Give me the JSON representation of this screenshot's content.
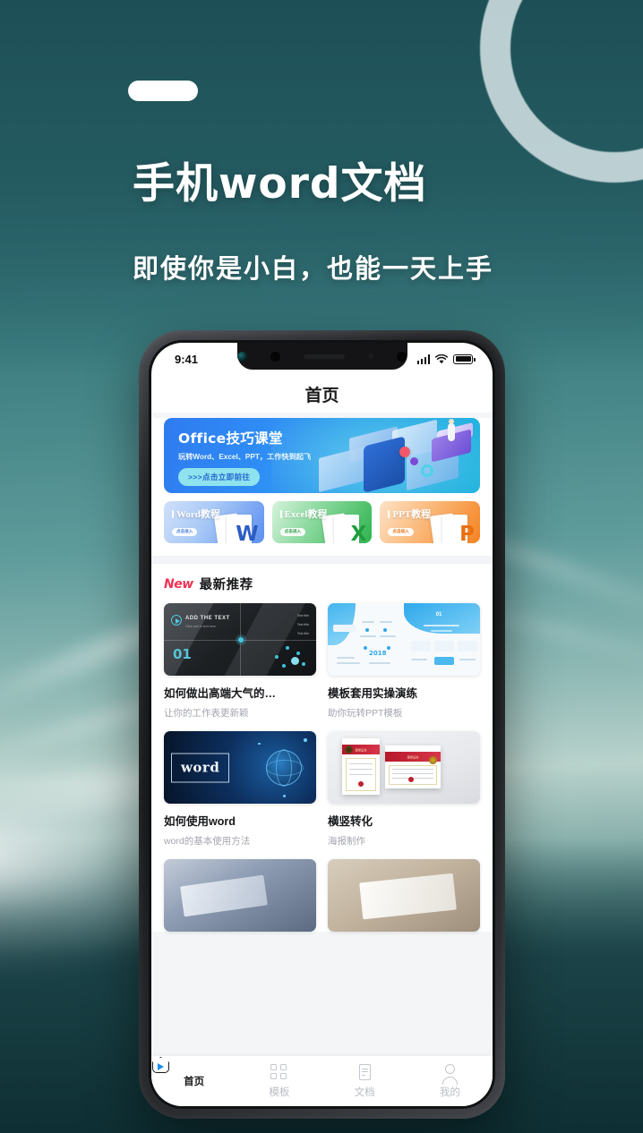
{
  "poster": {
    "headline": "手机word文档",
    "subheadline": "即使你是小白，也能一天上手"
  },
  "phone": {
    "status_bar": {
      "time": "9:41",
      "signal_icon": "signal-bars-icon",
      "wifi_icon": "wifi-icon",
      "battery_icon": "battery-icon"
    },
    "app_header": {
      "title": "首页"
    },
    "banner": {
      "title": "Office技巧课堂",
      "subtitle": "玩转Word、Excel、PPT，工作快到起飞",
      "button_label": ">>>点击立即前往"
    },
    "categories": [
      {
        "title": "Word教程",
        "badge": "点击进入",
        "letter": "W",
        "color": "#5b8ff0"
      },
      {
        "title": "Excel教程",
        "badge": "点击进入",
        "letter": "X",
        "color": "#2fb44f"
      },
      {
        "title": "PPT教程",
        "badge": "点击进入",
        "letter": "P",
        "color": "#f58220"
      }
    ],
    "recommend_section": {
      "badge": "New",
      "title": "最新推荐",
      "badge_color": "#ef3355",
      "cards": [
        {
          "title": "如何做出高端大气的…",
          "subtitle": "让你的工作表更新颖",
          "thumb_label": "ADD THE TEXT",
          "thumb_small": "Click add to text here",
          "thumb_number": "01",
          "thumb_r1": "Text  title",
          "thumb_r2": "Text  title",
          "thumb_r3": "Text  title"
        },
        {
          "title": "模板套用实操演练",
          "subtitle": "助你玩转PPT模板",
          "thumb_number": "01"
        },
        {
          "title": "如何使用word",
          "subtitle": "word的基本使用方法",
          "thumb_label": "word"
        },
        {
          "title": "横竖转化",
          "subtitle": "海报制作",
          "cert_band": "荣誉证书"
        }
      ]
    },
    "tabbar": [
      {
        "label": "首页",
        "icon": "home-icon",
        "active": true
      },
      {
        "label": "模板",
        "icon": "grid-icon",
        "active": false
      },
      {
        "label": "文档",
        "icon": "document-icon",
        "active": false
      },
      {
        "label": "我的",
        "icon": "person-icon",
        "active": false
      }
    ]
  }
}
